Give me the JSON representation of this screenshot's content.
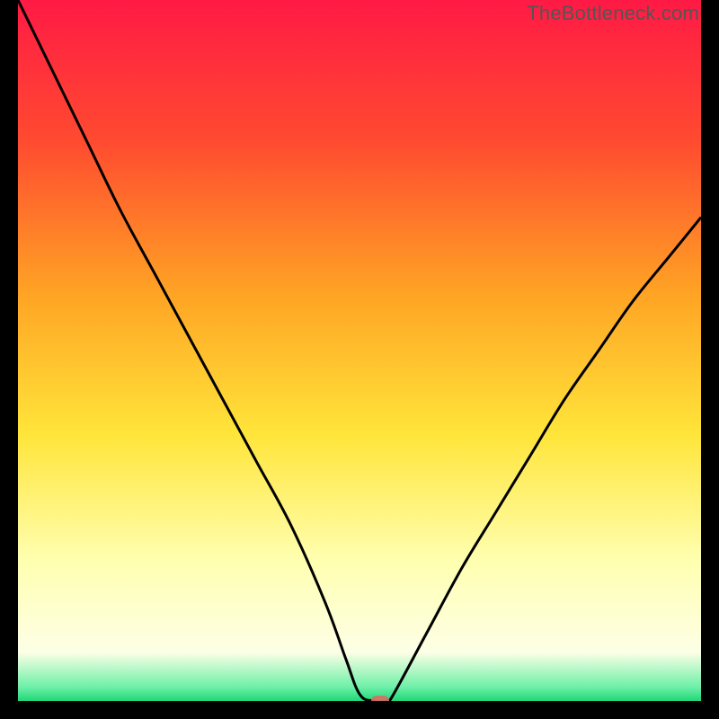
{
  "watermark": "TheBottleneck.com",
  "colors": {
    "top": "#ff1a45",
    "red": "#ff2a3a",
    "orange": "#ff8a2a",
    "yellow": "#ffe53a",
    "paleyellow": "#ffffb0",
    "cream": "#fdffe6",
    "green": "#28e07e",
    "frame": "#000000",
    "curve": "#000000",
    "marker": "#d76e64"
  },
  "chart_data": {
    "type": "line",
    "title": "",
    "xlabel": "",
    "ylabel": "",
    "xlim": [
      0,
      100
    ],
    "ylim": [
      0,
      100
    ],
    "series": [
      {
        "name": "curve",
        "x": [
          0,
          5,
          10,
          15,
          20,
          25,
          30,
          35,
          40,
          45,
          48,
          50,
          52,
          54,
          55,
          60,
          65,
          70,
          75,
          80,
          85,
          90,
          95,
          100
        ],
        "y": [
          100,
          90,
          80,
          70,
          61,
          52,
          43,
          34,
          25,
          14,
          6,
          1,
          0,
          0,
          1,
          10,
          19,
          27,
          35,
          43,
          50,
          57,
          63,
          69
        ]
      }
    ],
    "marker": {
      "x": 53,
      "y": 0
    },
    "gradient_stops": [
      {
        "pos": 0.0,
        "color": "#ff1a45"
      },
      {
        "pos": 0.2,
        "color": "#ff4a30"
      },
      {
        "pos": 0.42,
        "color": "#ffa424"
      },
      {
        "pos": 0.62,
        "color": "#ffe53a"
      },
      {
        "pos": 0.8,
        "color": "#ffffb0"
      },
      {
        "pos": 0.93,
        "color": "#fdffe6"
      },
      {
        "pos": 0.98,
        "color": "#6ef0a8"
      },
      {
        "pos": 1.0,
        "color": "#20d877"
      }
    ]
  }
}
